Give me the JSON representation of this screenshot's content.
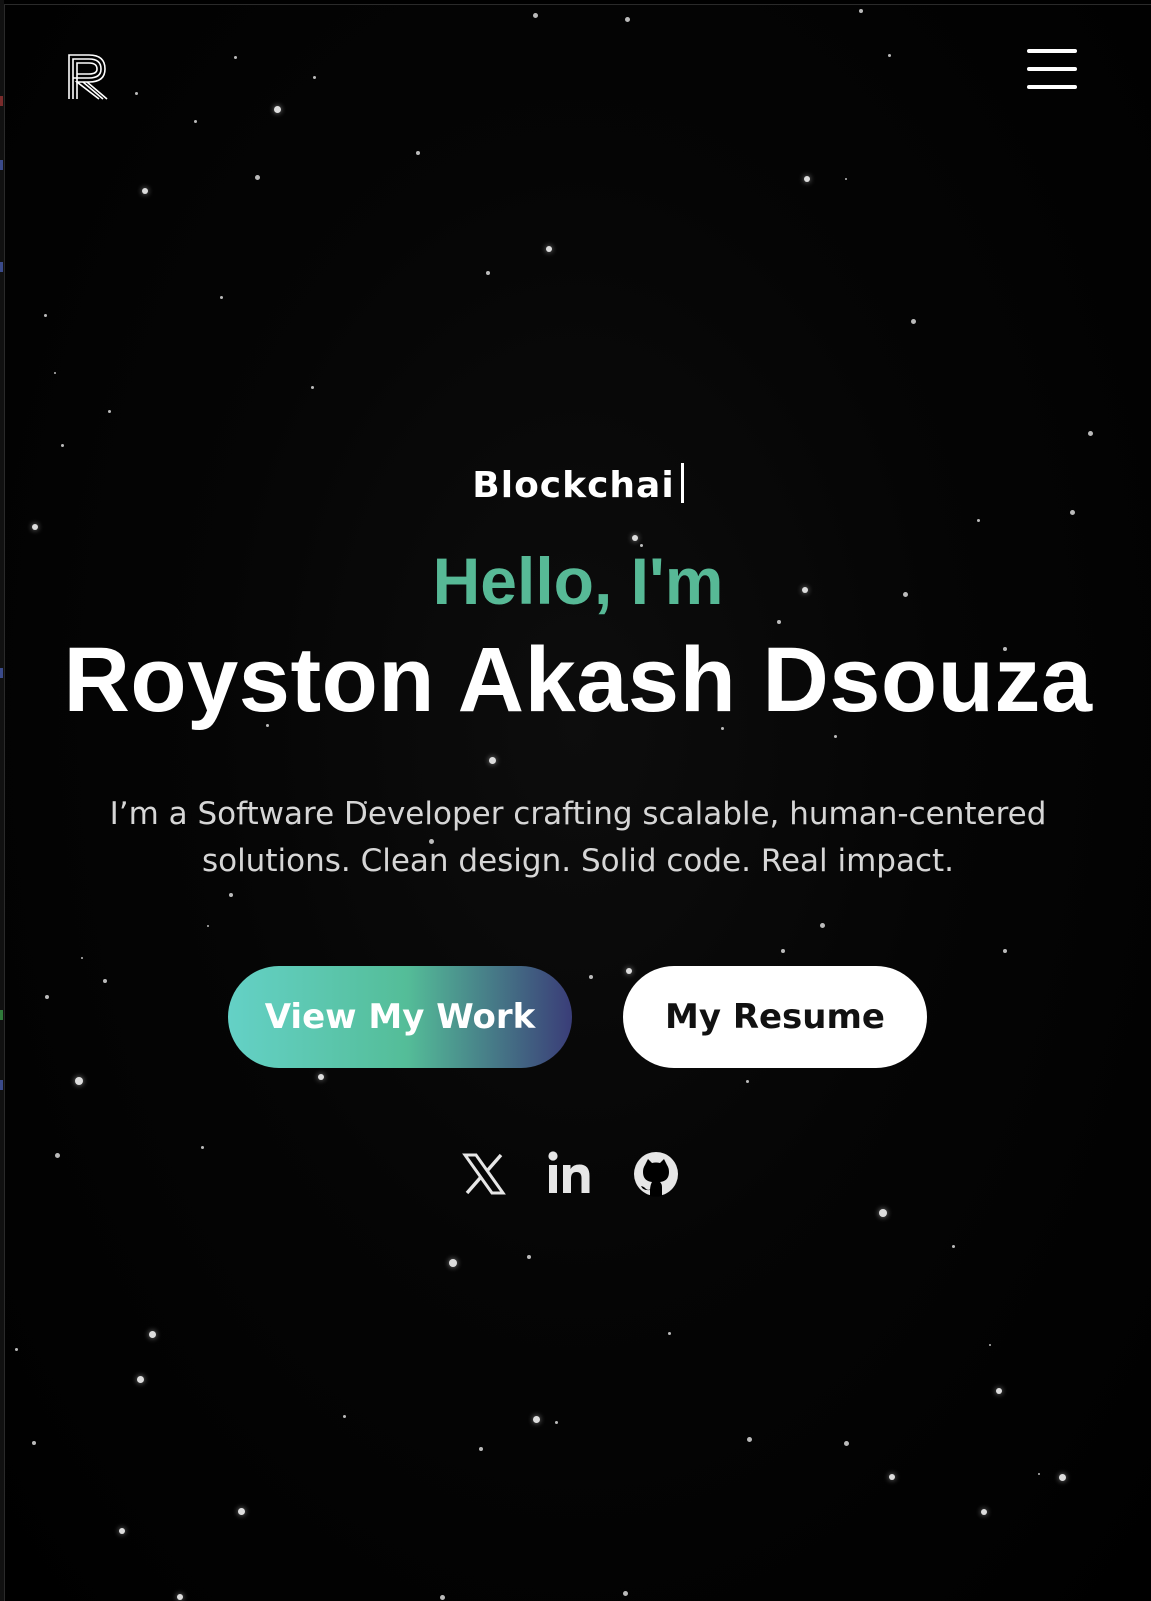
{
  "header": {
    "logo_letter": "R",
    "menu_icon": "hamburger-menu-icon"
  },
  "hero": {
    "typed_text": "Blockchai",
    "greeting": "Hello, I'm",
    "name": "Royston Akash Dsouza",
    "tagline_line1": "I’m a Software Developer crafting scalable, human-centered",
    "tagline_line2": "solutions. Clean design. Solid code. Real impact."
  },
  "buttons": {
    "view_work": "View My Work",
    "resume": "My Resume"
  },
  "socials": [
    {
      "icon": "x-twitter-icon"
    },
    {
      "icon": "linkedin-icon"
    },
    {
      "icon": "github-icon"
    }
  ],
  "colors": {
    "background": "#000000",
    "accent_green": "#57b996",
    "gradient_start": "#64d1c6",
    "gradient_mid": "#54bd98",
    "gradient_end": "#3a3d78",
    "text": "#ffffff"
  }
}
